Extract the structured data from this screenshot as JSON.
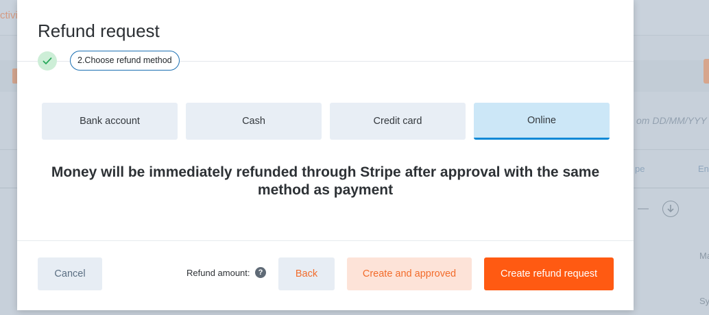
{
  "background": {
    "tab_fragment": "ctivi",
    "date_placeholder": "om  DD/MM/YYY",
    "column_1": "pe",
    "column_2": "En",
    "dash": "—",
    "row_text_1": "Ma",
    "row_text_2": "Sy"
  },
  "modal": {
    "title": "Refund request",
    "stepper": {
      "completed_icon": "check-icon",
      "current_step": "2.Choose refund method"
    },
    "methods": [
      {
        "label": "Bank account",
        "active": false
      },
      {
        "label": "Cash",
        "active": false
      },
      {
        "label": "Credit card",
        "active": false
      },
      {
        "label": "Online",
        "active": true
      }
    ],
    "message": "Money will be immediately refunded through Stripe after approval with the same method as payment",
    "footer": {
      "cancel_label": "Cancel",
      "refund_amount_label": "Refund amount:",
      "help_icon": "question-circle-icon",
      "help_glyph": "?",
      "back_label": "Back",
      "create_approved_label": "Create and approved",
      "create_label": "Create refund request"
    }
  },
  "colors": {
    "accent": "#ff5a12",
    "active_tab": "#cce7f7",
    "active_underline": "#0b88d6"
  }
}
